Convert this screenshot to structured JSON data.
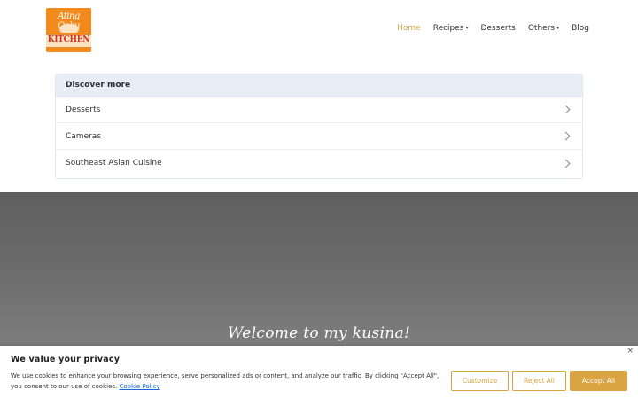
{
  "header": {
    "logo": {
      "top_text": "Ating Ooku",
      "bottom_text": "KITCHEN"
    },
    "nav": [
      {
        "label": "Home",
        "active": true,
        "has_dropdown": false
      },
      {
        "label": "Recipes",
        "active": false,
        "has_dropdown": true
      },
      {
        "label": "Desserts",
        "active": false,
        "has_dropdown": false
      },
      {
        "label": "Others",
        "active": false,
        "has_dropdown": true
      },
      {
        "label": "Blog",
        "active": false,
        "has_dropdown": false
      }
    ]
  },
  "discover": {
    "title": "Discover more",
    "items": [
      {
        "label": "Desserts"
      },
      {
        "label": "Cameras"
      },
      {
        "label": "Southeast Asian Cuisine"
      }
    ]
  },
  "hero": {
    "title": "Welcome to my kusina!"
  },
  "cookie_banner": {
    "title": "We value your privacy",
    "text": "We use cookies to enhance your browsing experience, serve personalized ads or content, and analyze our traffic. By clicking \"Accept All\", you consent to our use of cookies.",
    "link_label": "Cookie Policy",
    "close_label": "×",
    "buttons": {
      "customize": "Customize",
      "reject": "Reject All",
      "accept": "Accept All"
    }
  },
  "colors": {
    "accent": "#d9a441",
    "discover_header_bg": "#e8eef8",
    "link": "#1863dc"
  },
  "icons": {
    "nav_dropdown": "chevron-down-icon",
    "discover_row": "chevron-right-icon",
    "banner_close": "close-icon"
  }
}
